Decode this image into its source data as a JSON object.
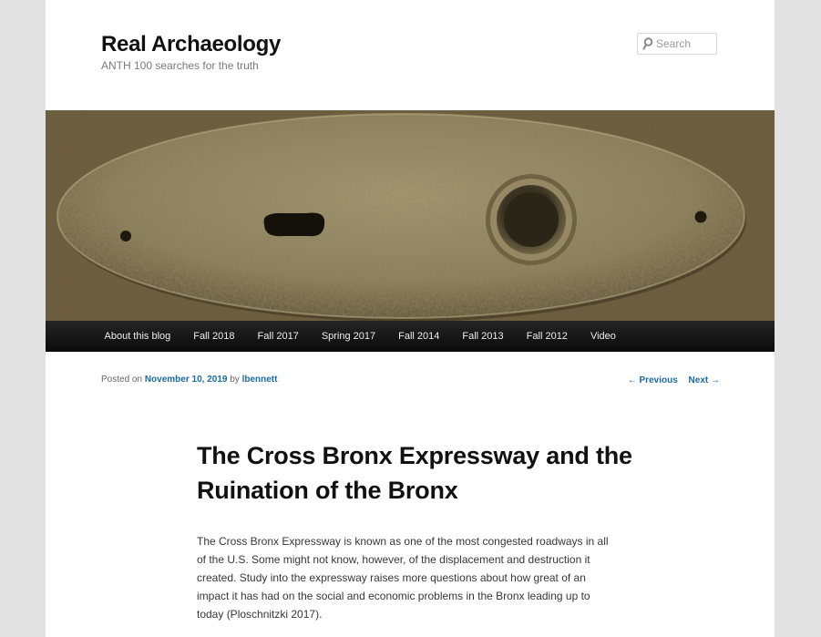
{
  "site": {
    "title": "Real Archaeology",
    "description": "ANTH 100 searches for the truth"
  },
  "search": {
    "placeholder": "Search",
    "icon": "search-icon"
  },
  "header_image": {
    "subject": "keyhole escutcheon plate",
    "tint": "#6b5c3a"
  },
  "nav": {
    "items": [
      {
        "label": "About this blog"
      },
      {
        "label": "Fall 2018"
      },
      {
        "label": "Fall 2017"
      },
      {
        "label": "Spring 2017"
      },
      {
        "label": "Fall 2014"
      },
      {
        "label": "Fall 2013"
      },
      {
        "label": "Fall 2012"
      },
      {
        "label": "Video"
      }
    ]
  },
  "post": {
    "posted_on": "Posted on",
    "date": "November 10, 2019",
    "by": "by",
    "author": "lbennett",
    "prev": "← Previous",
    "next": "Next →",
    "title": "The Cross Bronx Expressway and the Ruination of the Bronx",
    "body": "The Cross Bronx Expressway is known as one of the most congested roadways in all of the U.S. Some might not know, however, of the displacement and destruction it created. Study into the expressway raises more questions about how great of an impact it has had on the social and economic problems in the Bronx leading up to today (Ploschnitzki 2017)."
  },
  "colors": {
    "link": "#1b6aa5",
    "nav_bg": "#111111",
    "page_bg": "#e2e2e2"
  }
}
